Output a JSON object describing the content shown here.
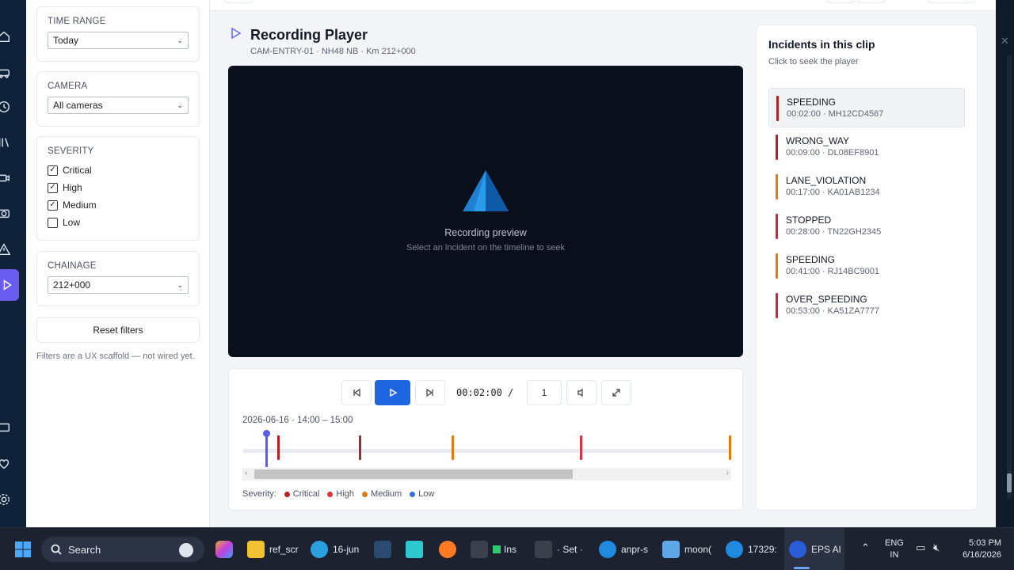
{
  "filters": {
    "time_range": {
      "label": "TIME RANGE",
      "value": "Today"
    },
    "camera": {
      "label": "CAMERA",
      "value": "All cameras"
    },
    "severity": {
      "label": "SEVERITY",
      "options": [
        {
          "label": "Critical",
          "checked": true
        },
        {
          "label": "High",
          "checked": true
        },
        {
          "label": "Medium",
          "checked": true
        },
        {
          "label": "Low",
          "checked": false
        }
      ]
    },
    "chainage": {
      "label": "CHAINAGE",
      "value": "212+000"
    },
    "reset_label": "Reset filters",
    "note": "Filters are a UX scaffold — not wired yet."
  },
  "player": {
    "title": "Recording Player",
    "subtitle": "CAM-ENTRY-01 · NH48 NB · Km 212+000",
    "preview_title": "Recording preview",
    "preview_hint": "Select an incident on the timeline to seek",
    "timecode": "00:02:00 /",
    "rate": "1",
    "timeline_range": "2026-06-16 · 14:00 – 15:00",
    "playhead_fraction": 0.047,
    "markers": [
      {
        "fraction": 0.071,
        "severity": "critical"
      },
      {
        "fraction": 0.238,
        "severity": "critical"
      },
      {
        "fraction": 0.428,
        "severity": "medium"
      },
      {
        "fraction": 0.69,
        "severity": "high"
      },
      {
        "fraction": 0.997,
        "severity": "medium"
      }
    ],
    "legend_label": "Severity:",
    "legend": [
      {
        "label": "Critical",
        "color": "#b42323"
      },
      {
        "label": "High",
        "color": "#e0313b"
      },
      {
        "label": "Medium",
        "color": "#e07b13"
      },
      {
        "label": "Low",
        "color": "#2f6fe0"
      }
    ]
  },
  "incidents": {
    "title": "Incidents in this clip",
    "subtitle": "Click to seek the player",
    "items": [
      {
        "name": "SPEEDING",
        "time": "00:02:00",
        "plate": "MH12CD4567",
        "color": "#b42323",
        "selected": true
      },
      {
        "name": "WRONG_WAY",
        "time": "00:09:00",
        "plate": "DL08EF8901",
        "color": "#b42323"
      },
      {
        "name": "LANE_VIOLATION",
        "time": "00:17:00",
        "plate": "KA01AB1234",
        "color": "#e07b13"
      },
      {
        "name": "STOPPED",
        "time": "00:28:00",
        "plate": "TN22GH2345",
        "color": "#c9283a"
      },
      {
        "name": "SPEEDING",
        "time": "00:41:00",
        "plate": "RJ14BC9001",
        "color": "#e07b13"
      },
      {
        "name": "OVER_SPEEDING",
        "time": "00:53:00",
        "plate": "KA51ZA7777",
        "color": "#c9283a"
      }
    ]
  },
  "taskbar": {
    "search_label": "Search",
    "apps": [
      {
        "label": "ref_scr"
      },
      {
        "label": "16-jun"
      },
      {
        "label": "Ins"
      },
      {
        "label": "· Set ·"
      },
      {
        "label": "anpr-s"
      },
      {
        "label": "moon("
      },
      {
        "label": "17329:"
      },
      {
        "label": "EPS Al"
      }
    ],
    "lang1": "ENG",
    "lang2": "IN",
    "time": "5:03 PM",
    "date": "6/16/2026"
  }
}
